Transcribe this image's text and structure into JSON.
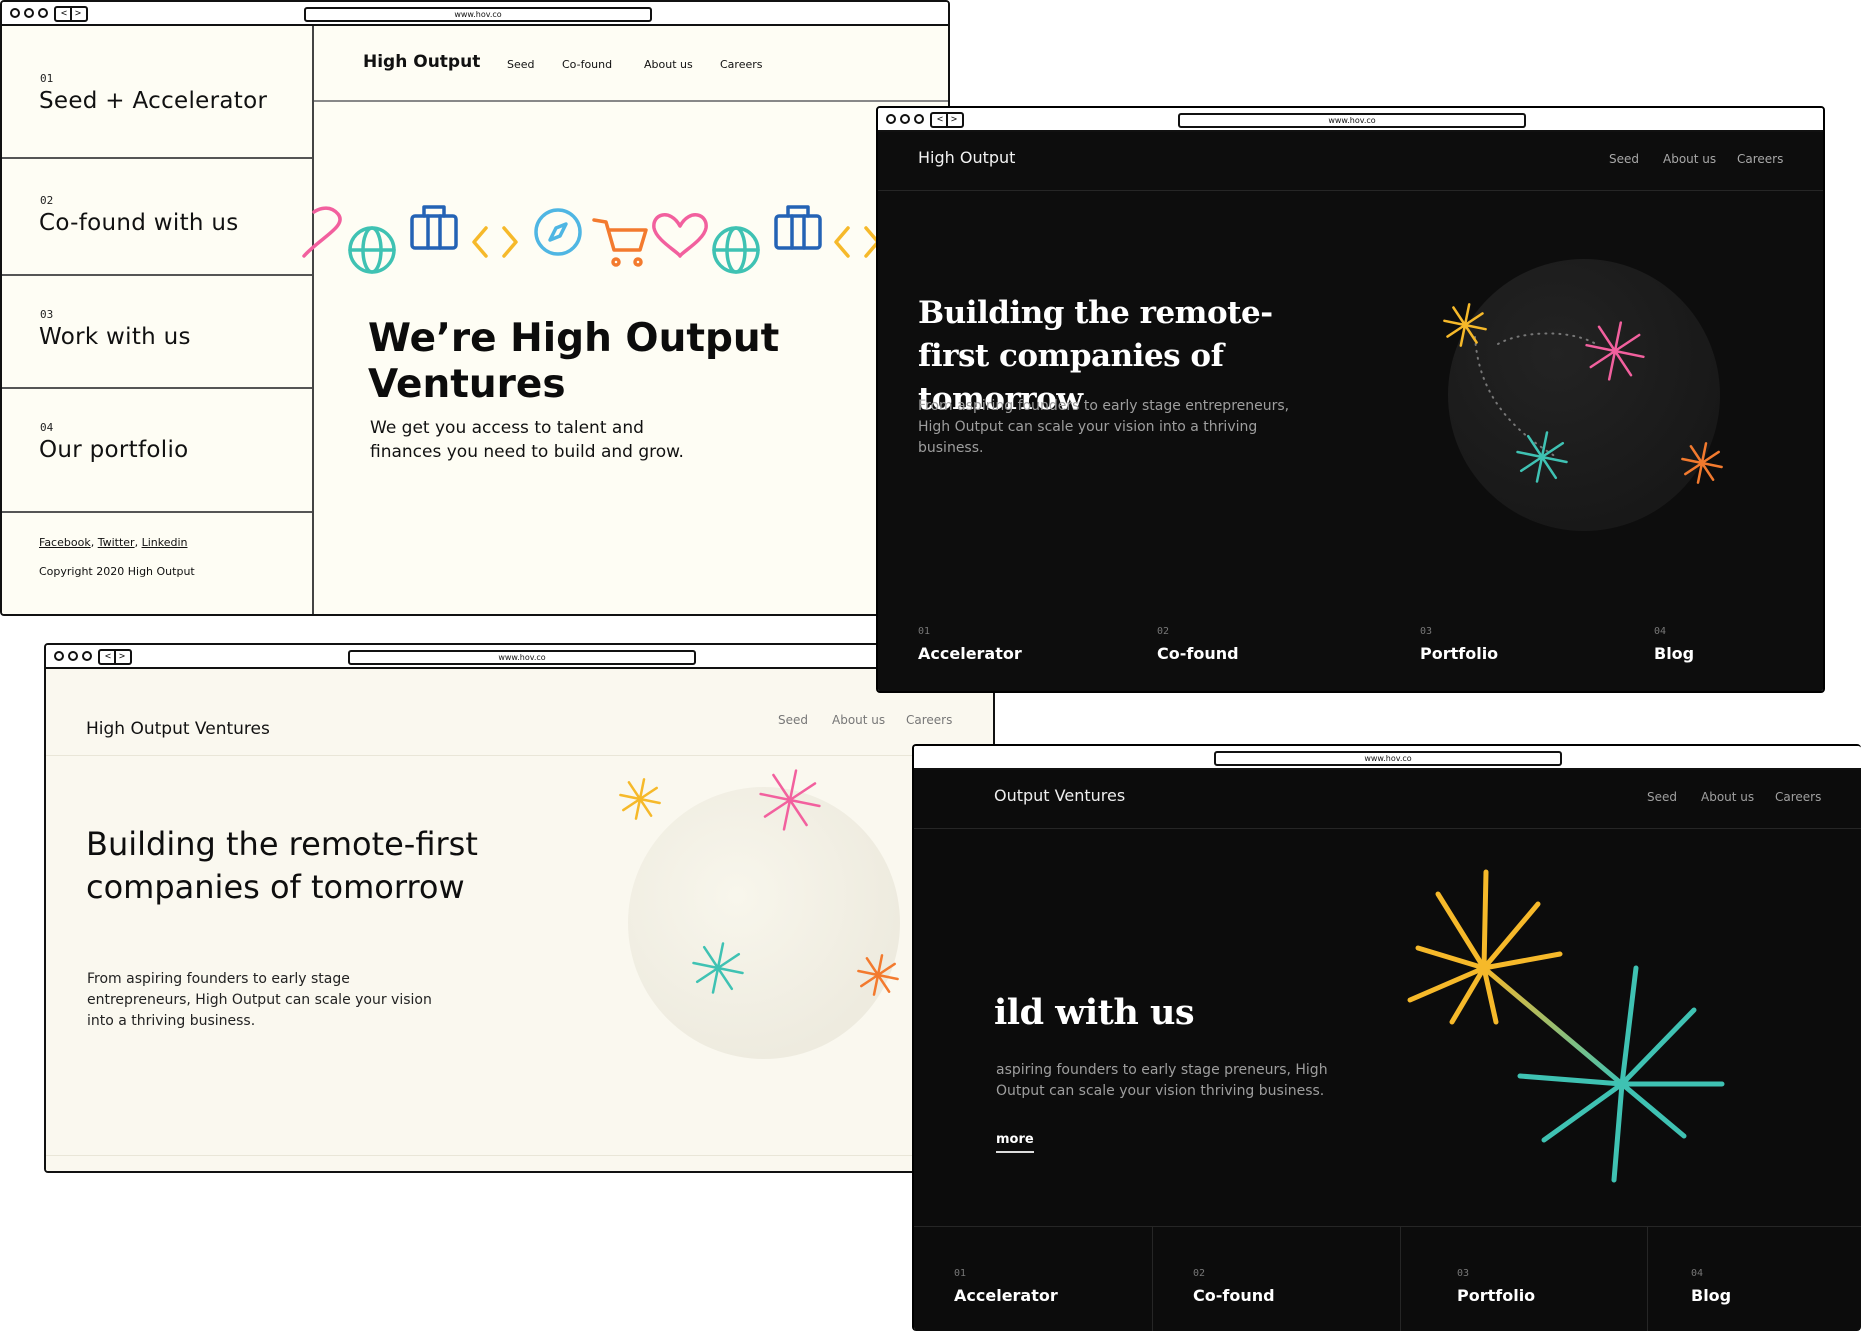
{
  "url": "www.hov.co",
  "window_light_sidebar": {
    "sidebar": {
      "items": [
        {
          "num": "01",
          "label": "Seed + Accelerator"
        },
        {
          "num": "02",
          "label": "Co-found with us"
        },
        {
          "num": "03",
          "label": "Work with us"
        },
        {
          "num": "04",
          "label": "Our portfolio"
        }
      ],
      "social": [
        "Facebook",
        "Twitter",
        "Linkedin"
      ],
      "copyright": "Copyright 2020 High Output"
    },
    "header": {
      "brand": "High Output",
      "nav": [
        "Seed",
        "Co-found",
        "About us",
        "Careers"
      ]
    },
    "hero": {
      "title": "We’re High Output Ventures",
      "subtitle": "We get you access to talent and finances you need to build and grow."
    },
    "icons": [
      "heart-icon",
      "globe-icon",
      "briefcase-icon",
      "code-icon",
      "compass-icon",
      "cart-icon",
      "heart-icon",
      "globe-icon",
      "briefcase-icon",
      "code-icon"
    ]
  },
  "window_dark_orbit": {
    "header": {
      "brand": "High Output",
      "nav": [
        "Seed",
        "About us",
        "Careers"
      ]
    },
    "hero": {
      "title": "Building the remote-first companies of tomorrow",
      "subtitle": "From aspiring founders to early stage entrepreneurs, High Output can scale your vision into a thriving business."
    },
    "features": [
      {
        "num": "01",
        "label": "Accelerator"
      },
      {
        "num": "02",
        "label": "Co-found"
      },
      {
        "num": "03",
        "label": "Portfolio"
      },
      {
        "num": "04",
        "label": "Blog"
      }
    ]
  },
  "window_light_orbit": {
    "header": {
      "brand": "High Output Ventures",
      "nav": [
        "Seed",
        "About us",
        "Careers"
      ]
    },
    "hero": {
      "title": "Building the remote-first companies of tomorrow",
      "subtitle": "From aspiring founders to early stage entrepreneurs, High Output can scale your vision into a thriving business."
    }
  },
  "window_dark_build": {
    "header": {
      "brand": "Output Ventures",
      "nav": [
        "Seed",
        "About us",
        "Careers"
      ]
    },
    "hero": {
      "title": "ild with us",
      "subtitle": "aspiring founders to early stage preneurs, High Output can scale your vision thriving business.",
      "more": "more"
    },
    "features": [
      {
        "num": "01",
        "label": "Accelerator"
      },
      {
        "num": "02",
        "label": "Co-found"
      },
      {
        "num": "03",
        "label": "Portfolio"
      },
      {
        "num": "04",
        "label": "Blog"
      }
    ]
  },
  "colors": {
    "yellow": "#f6b92a",
    "pink": "#f2609e",
    "teal": "#3fc2b3",
    "orange": "#f37a2e",
    "blue": "#2463b5",
    "light_blue": "#4fb6e3"
  }
}
